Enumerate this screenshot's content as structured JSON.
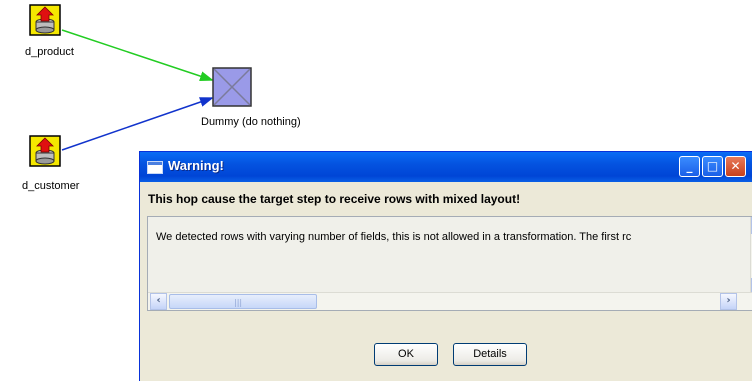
{
  "canvas": {
    "steps": [
      {
        "id": "d_product",
        "label": "d_product",
        "icon": "table-input-icon"
      },
      {
        "id": "d_customer",
        "label": "d_customer",
        "icon": "table-input-icon"
      },
      {
        "id": "dummy",
        "label": "Dummy (do nothing)",
        "icon": "dummy-icon"
      }
    ],
    "hops": [
      {
        "from": "d_product",
        "to": "dummy",
        "color": "#22cc22"
      },
      {
        "from": "d_customer",
        "to": "dummy",
        "color": "#1133cc"
      }
    ]
  },
  "dialog": {
    "title": "Warning!",
    "message": "This hop cause the target step to receive rows with mixed layout!",
    "details_text": "We detected rows with varying number of fields, this is not allowed in a transformation.  The first rc",
    "buttons": {
      "ok": "OK",
      "details": "Details"
    },
    "window_controls": [
      "minimize-icon",
      "maximize-icon",
      "close-icon"
    ]
  },
  "colors": {
    "titlebar": "#0054e3",
    "hop_green": "#22cc22",
    "hop_blue": "#1133cc",
    "dialog_bg": "#ece9d8"
  }
}
